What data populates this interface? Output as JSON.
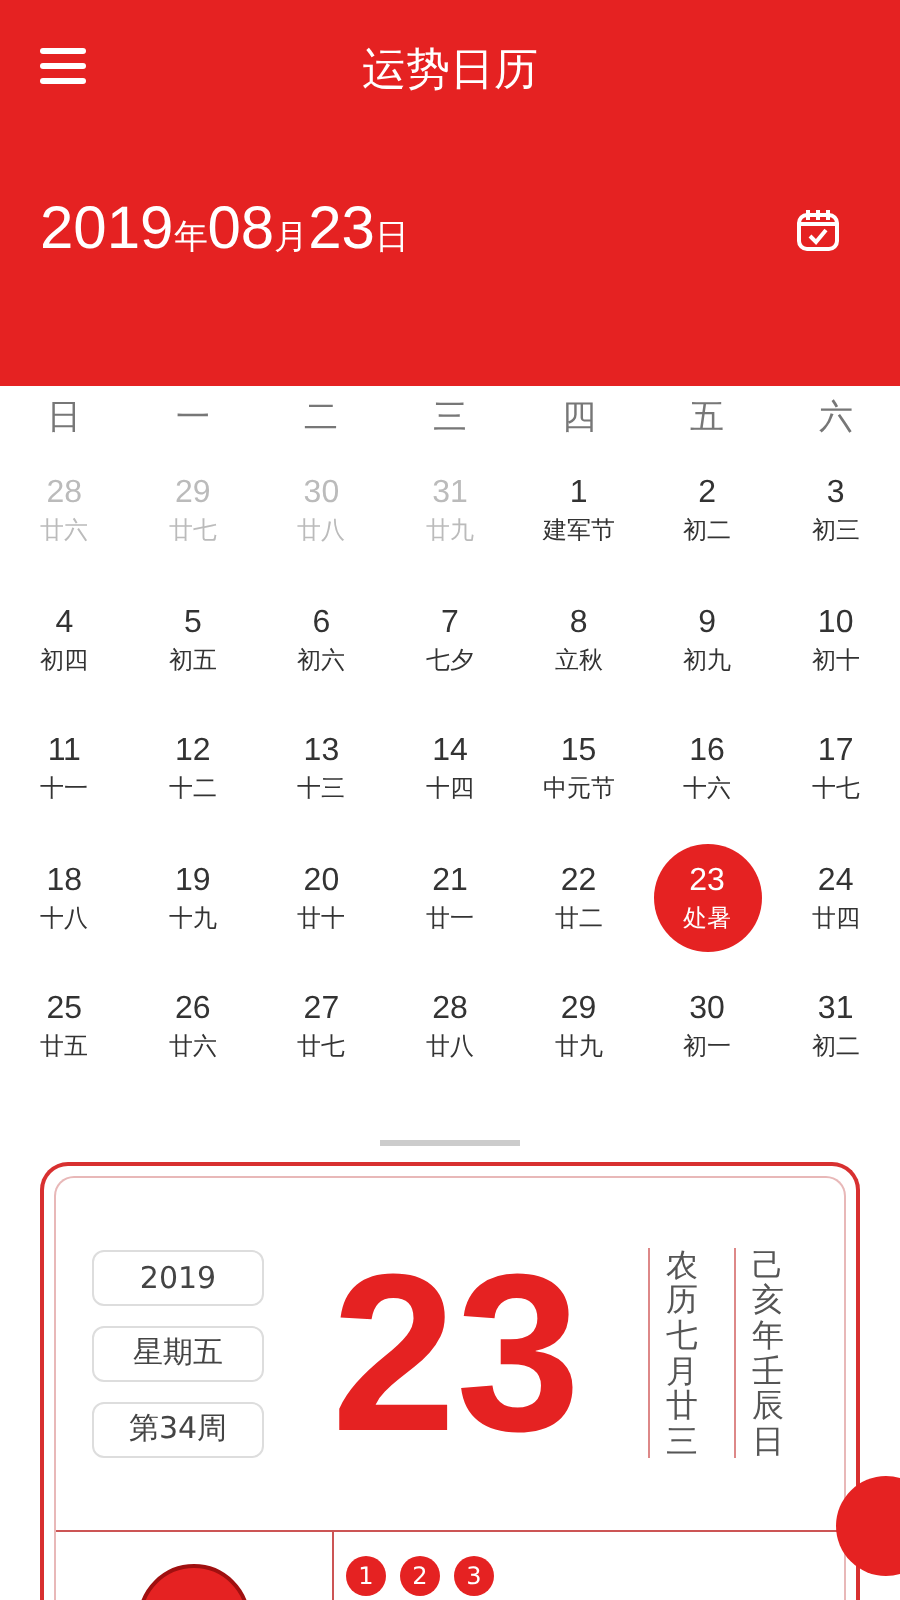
{
  "header": {
    "title": "运势日历",
    "date": "2019年08月23日"
  },
  "weekdays": [
    "日",
    "一",
    "二",
    "三",
    "四",
    "五",
    "六"
  ],
  "weeks": [
    [
      {
        "day": "28",
        "lunar": "廿六",
        "other_month": true,
        "selected": false
      },
      {
        "day": "29",
        "lunar": "廿七",
        "other_month": true,
        "selected": false
      },
      {
        "day": "30",
        "lunar": "廿八",
        "other_month": true,
        "selected": false
      },
      {
        "day": "31",
        "lunar": "廿九",
        "other_month": true,
        "selected": false
      },
      {
        "day": "1",
        "lunar": "建军节",
        "other_month": false,
        "selected": false
      },
      {
        "day": "2",
        "lunar": "初二",
        "other_month": false,
        "selected": false
      },
      {
        "day": "3",
        "lunar": "初三",
        "other_month": false,
        "selected": false
      }
    ],
    [
      {
        "day": "4",
        "lunar": "初四",
        "other_month": false,
        "selected": false
      },
      {
        "day": "5",
        "lunar": "初五",
        "other_month": false,
        "selected": false
      },
      {
        "day": "6",
        "lunar": "初六",
        "other_month": false,
        "selected": false
      },
      {
        "day": "7",
        "lunar": "七夕",
        "other_month": false,
        "selected": false
      },
      {
        "day": "8",
        "lunar": "立秋",
        "other_month": false,
        "selected": false
      },
      {
        "day": "9",
        "lunar": "初九",
        "other_month": false,
        "selected": false
      },
      {
        "day": "10",
        "lunar": "初十",
        "other_month": false,
        "selected": false
      }
    ],
    [
      {
        "day": "11",
        "lunar": "十一",
        "other_month": false,
        "selected": false
      },
      {
        "day": "12",
        "lunar": "十二",
        "other_month": false,
        "selected": false
      },
      {
        "day": "13",
        "lunar": "十三",
        "other_month": false,
        "selected": false
      },
      {
        "day": "14",
        "lunar": "十四",
        "other_month": false,
        "selected": false
      },
      {
        "day": "15",
        "lunar": "中元节",
        "other_month": false,
        "selected": false
      },
      {
        "day": "16",
        "lunar": "十六",
        "other_month": false,
        "selected": false
      },
      {
        "day": "17",
        "lunar": "十七",
        "other_month": false,
        "selected": false
      }
    ],
    [
      {
        "day": "18",
        "lunar": "十八",
        "other_month": false,
        "selected": false
      },
      {
        "day": "19",
        "lunar": "十九",
        "other_month": false,
        "selected": false
      },
      {
        "day": "20",
        "lunar": "廿十",
        "other_month": false,
        "selected": false
      },
      {
        "day": "21",
        "lunar": "廿一",
        "other_month": false,
        "selected": false
      },
      {
        "day": "22",
        "lunar": "廿二",
        "other_month": false,
        "selected": false
      },
      {
        "day": "23",
        "lunar": "处暑",
        "other_month": false,
        "selected": true
      },
      {
        "day": "24",
        "lunar": "廿四",
        "other_month": false,
        "selected": false
      }
    ],
    [
      {
        "day": "25",
        "lunar": "廿五",
        "other_month": false,
        "selected": false
      },
      {
        "day": "26",
        "lunar": "廿六",
        "other_month": false,
        "selected": false
      },
      {
        "day": "27",
        "lunar": "廿七",
        "other_month": false,
        "selected": false
      },
      {
        "day": "28",
        "lunar": "廿八",
        "other_month": false,
        "selected": false
      },
      {
        "day": "29",
        "lunar": "廿九",
        "other_month": false,
        "selected": false
      },
      {
        "day": "30",
        "lunar": "初一",
        "other_month": false,
        "selected": false
      },
      {
        "day": "31",
        "lunar": "初二",
        "other_month": false,
        "selected": false
      }
    ]
  ],
  "day_card": {
    "tags": [
      "2019",
      "星期五",
      "第34周"
    ],
    "big_day": "23",
    "lunar_date": "农历七月廿三",
    "ganzhi": "己亥年壬辰日",
    "numbers": [
      "1",
      "2",
      "3"
    ]
  }
}
